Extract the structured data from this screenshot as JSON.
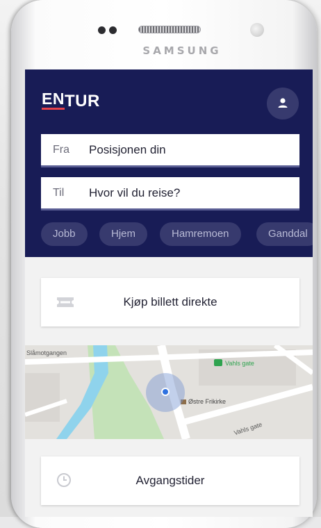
{
  "device": {
    "brand": "SAMSUNG"
  },
  "app": {
    "logo_en": "EN",
    "logo_tur": "TUR",
    "profile_icon": "person-icon"
  },
  "search": {
    "from_label": "Fra",
    "from_value": "Posisjonen din",
    "to_label": "Til",
    "to_value": "Hvor vil du reise?"
  },
  "chips": [
    "Jobb",
    "Hjem",
    "Hamremoen",
    "Ganddal"
  ],
  "ticket_card": {
    "icon": "ticket-icon",
    "label": "Kjøp billett direkte"
  },
  "map": {
    "street_1": "Slåmotgangen",
    "street_2": "Vahls gate",
    "bus_stop": "Vahls gate",
    "church": "Østre Frikirke"
  },
  "departures_card": {
    "icon": "clock-icon",
    "label": "Avgangstider"
  },
  "colors": {
    "header": "#181c56",
    "accent_red": "#e8424a",
    "location_blue": "#2e71e0"
  }
}
